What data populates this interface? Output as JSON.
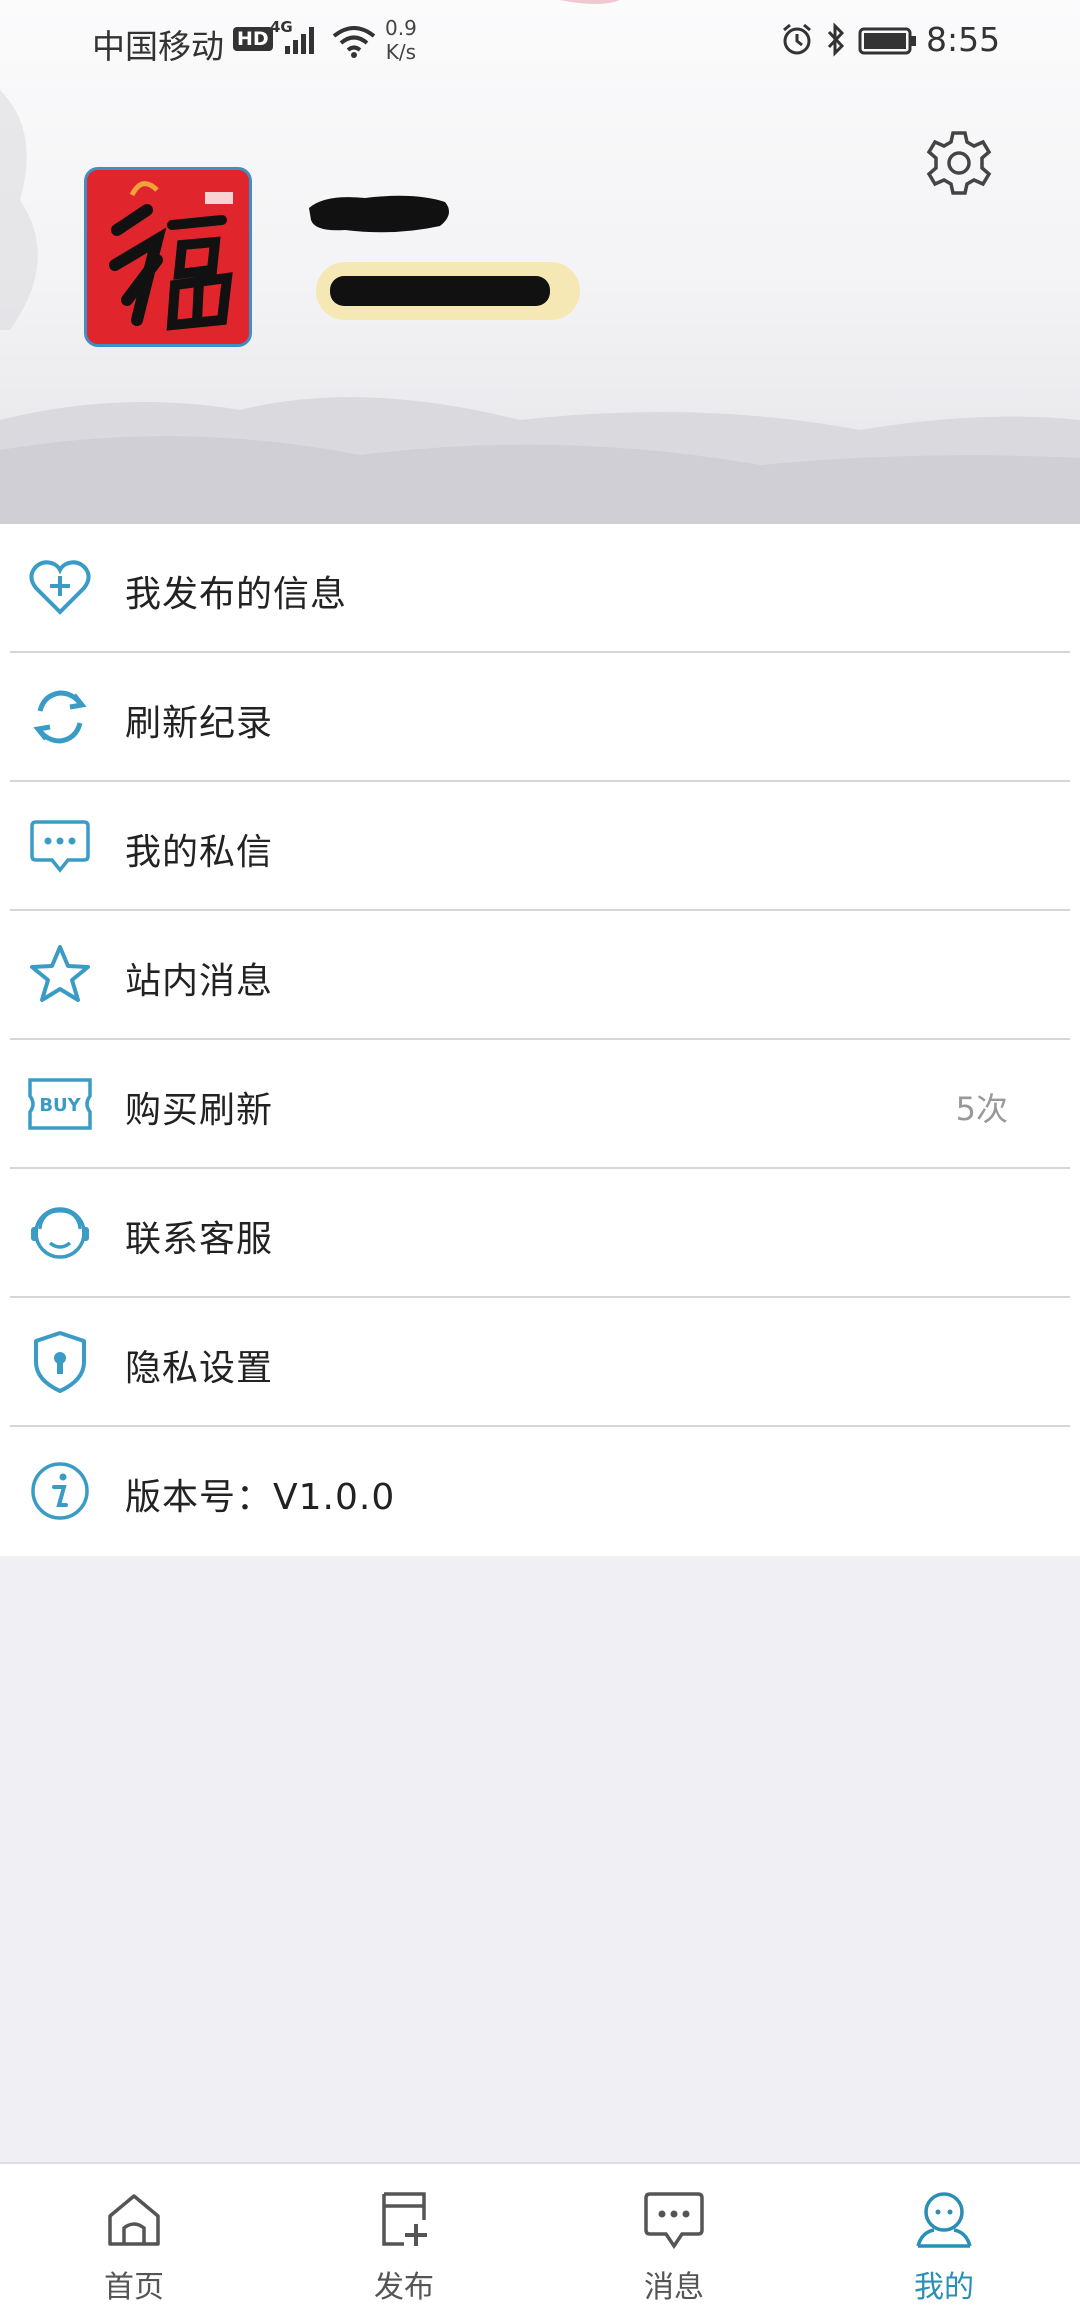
{
  "status_bar": {
    "carrier": "中国移动",
    "hd_badge": "HD",
    "network": "4G",
    "speed_value": "0.9",
    "speed_unit": "K/s",
    "time": "8:55"
  },
  "header": {
    "settings_icon": "gear-icon",
    "avatar_image": "fu-character-avatar"
  },
  "menu": {
    "items": [
      {
        "label": "我发布的信息",
        "icon": "heart-plus-icon",
        "value": ""
      },
      {
        "label": "刷新纪录",
        "icon": "refresh-icon",
        "value": ""
      },
      {
        "label": "我的私信",
        "icon": "chat-bubble-icon",
        "value": ""
      },
      {
        "label": "站内消息",
        "icon": "star-icon",
        "value": ""
      },
      {
        "label": "购买刷新",
        "icon": "buy-ticket-icon",
        "value": "5次"
      },
      {
        "label": "联系客服",
        "icon": "headset-icon",
        "value": ""
      },
      {
        "label": "隐私设置",
        "icon": "shield-lock-icon",
        "value": ""
      },
      {
        "label": "版本号：V1.0.0",
        "icon": "info-icon",
        "value": ""
      }
    ]
  },
  "tabbar": {
    "tabs": [
      {
        "label": "首页",
        "icon": "home-icon",
        "active": false
      },
      {
        "label": "发布",
        "icon": "publish-icon",
        "active": false
      },
      {
        "label": "消息",
        "icon": "message-icon",
        "active": false
      },
      {
        "label": "我的",
        "icon": "profile-icon",
        "active": true
      }
    ]
  },
  "colors": {
    "accent": "#2a8fb6",
    "icon_blue": "#3a9cc6",
    "background": "#efeff4",
    "divider": "#d6d6d6"
  }
}
